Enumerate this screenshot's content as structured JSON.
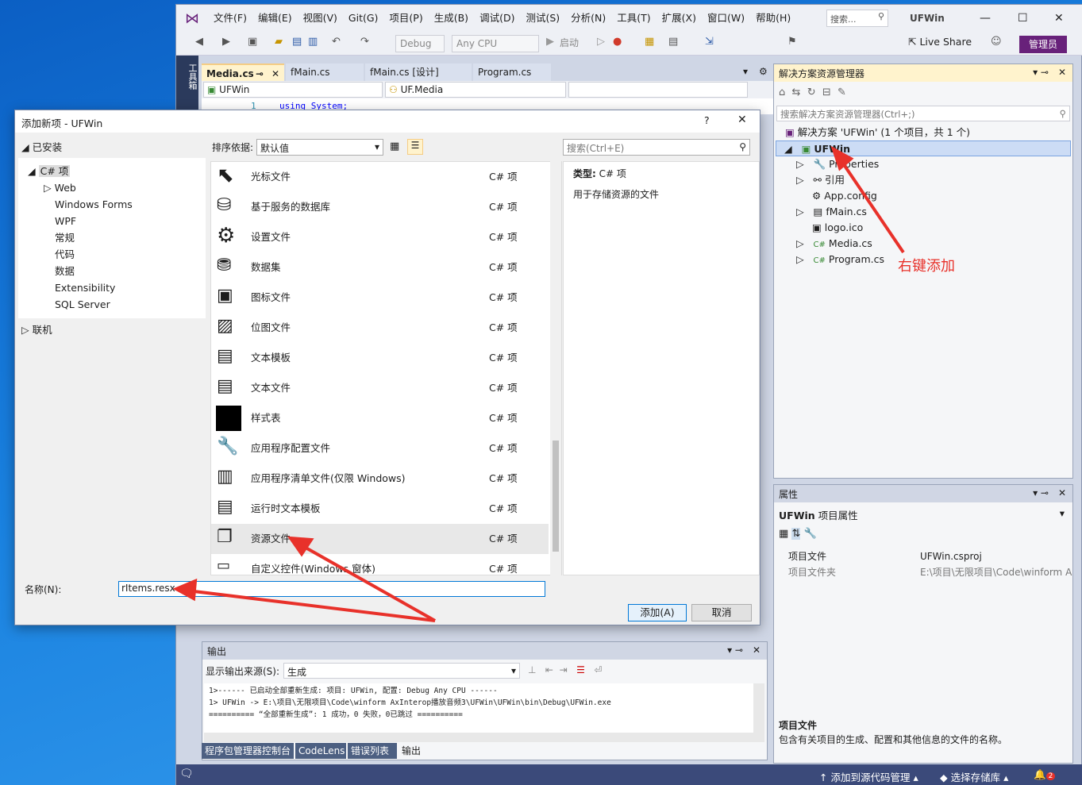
{
  "vs": {
    "menu": [
      "文件(F)",
      "编辑(E)",
      "视图(V)",
      "Git(G)",
      "项目(P)",
      "生成(B)",
      "调试(D)",
      "测试(S)",
      "分析(N)",
      "工具(T)",
      "扩展(X)",
      "窗口(W)",
      "帮助(H)"
    ],
    "search_placeholder": "搜索...",
    "app_name": "UFWin",
    "toolbar": {
      "config": "Debug",
      "platform": "Any CPU",
      "start": "启动",
      "live_share": "Live Share",
      "admin": "管理员"
    },
    "left_strip": "工具箱",
    "doc_tabs": [
      "Media.cs",
      "fMain.cs",
      "fMain.cs [设计]",
      "Program.cs"
    ],
    "nav": {
      "project": "UFWin",
      "class": "UF.Media"
    },
    "code_line": {
      "num": "1",
      "text": "using System;"
    }
  },
  "solution_explorer": {
    "title": "解决方案资源管理器",
    "search_placeholder": "搜索解决方案资源管理器(Ctrl+;)",
    "solution": "解决方案 'UFWin' (1 个项目，共 1 个)",
    "project": "UFWin",
    "items": [
      "Properties",
      "引用",
      "App.config",
      "fMain.cs",
      "logo.ico",
      "Media.cs",
      "Program.cs"
    ]
  },
  "annotation": {
    "right_click": "右键添加"
  },
  "properties": {
    "title": "属性",
    "subject": "UFWin",
    "subject_type": "项目属性",
    "rows": [
      {
        "k": "项目文件",
        "v": "UFWin.csproj"
      },
      {
        "k": "项目文件夹",
        "v": "E:\\项目\\无限项目\\Code\\winform A"
      }
    ],
    "desc_title": "项目文件",
    "desc_text": "包含有关项目的生成、配置和其他信息的文件的名称。"
  },
  "output": {
    "title": "输出",
    "source_label": "显示输出来源(S):",
    "source_value": "生成",
    "lines": [
      "1>------ 已启动全部重新生成: 项目: UFWin, 配置: Debug Any CPU ------",
      "1>  UFWin -> E:\\项目\\无限项目\\Code\\winform AxInterop播放音频3\\UFWin\\UFWin\\bin\\Debug\\UFWin.exe",
      "========== “全部重新生成”: 1 成功，0 失败，0已跳过 =========="
    ],
    "tabs": [
      "程序包管理器控制台",
      "CodeLens",
      "错误列表",
      "输出"
    ]
  },
  "statusbar": {
    "add_source": "添加到源代码管理",
    "select_repo": "选择存储库",
    "notify_count": "2"
  },
  "dialog": {
    "title": "添加新项 - UFWin",
    "help": "?",
    "installed": "已安装",
    "tree_root": "C# 项",
    "tree": [
      "Web",
      "Windows Forms",
      "WPF",
      "常规",
      "代码",
      "数据",
      "Extensibility",
      "SQL Server"
    ],
    "online": "联机",
    "sort_label": "排序依据:",
    "sort_value": "默认值",
    "search_placeholder": "搜索(Ctrl+E)",
    "items": [
      {
        "name": "光标文件",
        "type": "C# 项"
      },
      {
        "name": "基于服务的数据库",
        "type": "C# 项"
      },
      {
        "name": "设置文件",
        "type": "C# 项"
      },
      {
        "name": "数据集",
        "type": "C# 项"
      },
      {
        "name": "图标文件",
        "type": "C# 项"
      },
      {
        "name": "位图文件",
        "type": "C# 项"
      },
      {
        "name": "文本模板",
        "type": "C# 项"
      },
      {
        "name": "文本文件",
        "type": "C# 项"
      },
      {
        "name": "样式表",
        "type": "C# 项"
      },
      {
        "name": "应用程序配置文件",
        "type": "C# 项"
      },
      {
        "name": "应用程序清单文件(仅限 Windows)",
        "type": "C# 项"
      },
      {
        "name": "运行时文本模板",
        "type": "C# 项"
      },
      {
        "name": "资源文件",
        "type": "C# 项"
      },
      {
        "name": "自定义控件(Windows 窗体)",
        "type": "C# 项"
      }
    ],
    "detail_type_label": "类型:",
    "detail_type_value": "C# 项",
    "detail_desc": "用于存储资源的文件",
    "name_label": "名称(N):",
    "name_value": "rItems.resx",
    "add_button": "添加(A)",
    "cancel_button": "取消"
  }
}
